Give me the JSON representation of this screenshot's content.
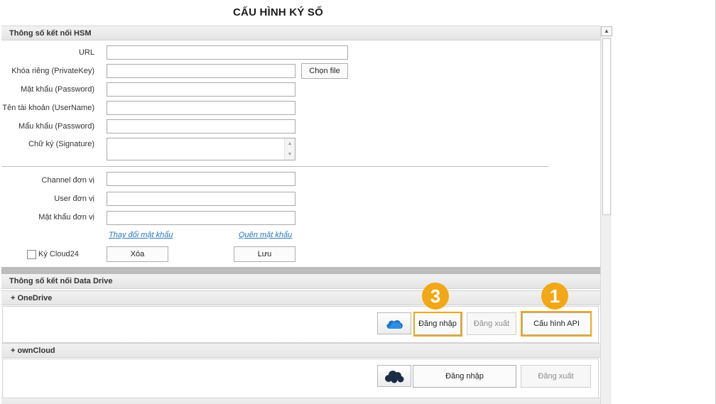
{
  "page": {
    "title": "CẤU HÌNH KÝ SỐ"
  },
  "hsm": {
    "header": "Thông số kết nối HSM",
    "fields": {
      "url": {
        "label": "URL",
        "value": ""
      },
      "private_key": {
        "label": "Khóa riêng (PrivateKey)",
        "value": ""
      },
      "password": {
        "label": "Mật khẩu (Password)",
        "value": ""
      },
      "username": {
        "label": "Tên tài khoản (UserName)",
        "value": ""
      },
      "password2": {
        "label": "Mẩu khẩu (Password)",
        "value": ""
      },
      "signature": {
        "label": "Chữ ký (Signature)",
        "value": ""
      }
    },
    "choose_file_button": "Chọn file",
    "unit": {
      "channel": {
        "label": "Channel đơn vị",
        "value": ""
      },
      "user": {
        "label": "User đơn vị",
        "value": ""
      },
      "password": {
        "label": "Mật khẩu đơn vị",
        "value": ""
      }
    },
    "change_password_link": "Thay đổi mật khẩu",
    "forgot_password_link": "Quên mật khẩu",
    "cloud24_checkbox_label": "Ký Cloud24",
    "cloud24_checked": false,
    "delete_button": "Xóa",
    "save_button": "Lưu"
  },
  "data_drive": {
    "header": "Thông số kết nối Data Drive",
    "onedrive": {
      "header": "+ OneDrive",
      "icon": "onedrive-cloud-icon",
      "login_button": "Đăng nhập",
      "logout_button": "Đăng xuất",
      "config_api_button": "Cấu hình API"
    },
    "owncloud": {
      "header": "+ ownCloud",
      "icon": "owncloud-cloud-icon",
      "login_button": "Đăng nhập",
      "logout_button": "Đăng xuất"
    }
  },
  "annotations": {
    "badge_1": "1",
    "badge_3": "3",
    "highlight_color": "#f2a716"
  },
  "colors": {
    "link": "#2a7ab8",
    "onedrive_blue": "#1e74c8",
    "owncloud_dark": "#1c2c44"
  }
}
